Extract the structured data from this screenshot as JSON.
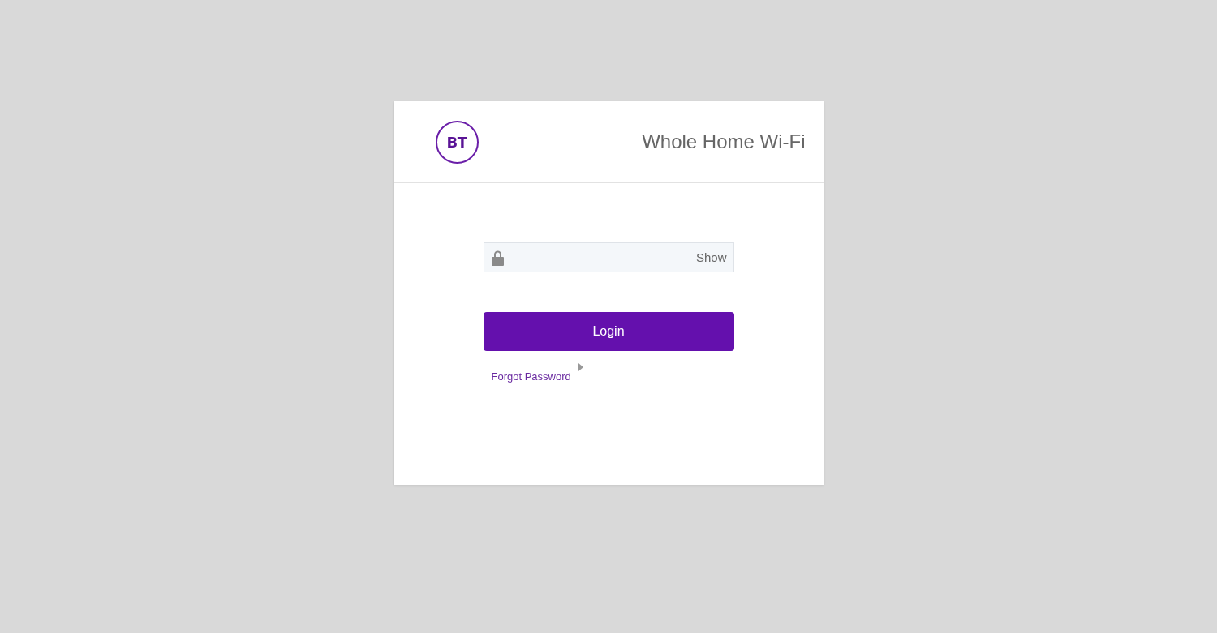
{
  "header": {
    "logo": "BT",
    "title": "Whole Home Wi-Fi"
  },
  "password_field": {
    "toggle": "Show"
  },
  "login_button": "Login",
  "forgot_link": "Forgot Password"
}
